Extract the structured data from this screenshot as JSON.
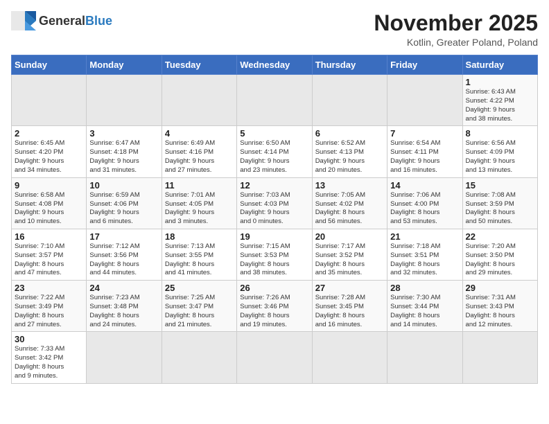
{
  "logo": {
    "text_general": "General",
    "text_blue": "Blue"
  },
  "header": {
    "title": "November 2025",
    "subtitle": "Kotlin, Greater Poland, Poland"
  },
  "weekdays": [
    "Sunday",
    "Monday",
    "Tuesday",
    "Wednesday",
    "Thursday",
    "Friday",
    "Saturday"
  ],
  "weeks": [
    [
      {
        "day": "",
        "info": ""
      },
      {
        "day": "",
        "info": ""
      },
      {
        "day": "",
        "info": ""
      },
      {
        "day": "",
        "info": ""
      },
      {
        "day": "",
        "info": ""
      },
      {
        "day": "",
        "info": ""
      },
      {
        "day": "1",
        "info": "Sunrise: 6:43 AM\nSunset: 4:22 PM\nDaylight: 9 hours\nand 38 minutes."
      }
    ],
    [
      {
        "day": "2",
        "info": "Sunrise: 6:45 AM\nSunset: 4:20 PM\nDaylight: 9 hours\nand 34 minutes."
      },
      {
        "day": "3",
        "info": "Sunrise: 6:47 AM\nSunset: 4:18 PM\nDaylight: 9 hours\nand 31 minutes."
      },
      {
        "day": "4",
        "info": "Sunrise: 6:49 AM\nSunset: 4:16 PM\nDaylight: 9 hours\nand 27 minutes."
      },
      {
        "day": "5",
        "info": "Sunrise: 6:50 AM\nSunset: 4:14 PM\nDaylight: 9 hours\nand 23 minutes."
      },
      {
        "day": "6",
        "info": "Sunrise: 6:52 AM\nSunset: 4:13 PM\nDaylight: 9 hours\nand 20 minutes."
      },
      {
        "day": "7",
        "info": "Sunrise: 6:54 AM\nSunset: 4:11 PM\nDaylight: 9 hours\nand 16 minutes."
      },
      {
        "day": "8",
        "info": "Sunrise: 6:56 AM\nSunset: 4:09 PM\nDaylight: 9 hours\nand 13 minutes."
      }
    ],
    [
      {
        "day": "9",
        "info": "Sunrise: 6:58 AM\nSunset: 4:08 PM\nDaylight: 9 hours\nand 10 minutes."
      },
      {
        "day": "10",
        "info": "Sunrise: 6:59 AM\nSunset: 4:06 PM\nDaylight: 9 hours\nand 6 minutes."
      },
      {
        "day": "11",
        "info": "Sunrise: 7:01 AM\nSunset: 4:05 PM\nDaylight: 9 hours\nand 3 minutes."
      },
      {
        "day": "12",
        "info": "Sunrise: 7:03 AM\nSunset: 4:03 PM\nDaylight: 9 hours\nand 0 minutes."
      },
      {
        "day": "13",
        "info": "Sunrise: 7:05 AM\nSunset: 4:02 PM\nDaylight: 8 hours\nand 56 minutes."
      },
      {
        "day": "14",
        "info": "Sunrise: 7:06 AM\nSunset: 4:00 PM\nDaylight: 8 hours\nand 53 minutes."
      },
      {
        "day": "15",
        "info": "Sunrise: 7:08 AM\nSunset: 3:59 PM\nDaylight: 8 hours\nand 50 minutes."
      }
    ],
    [
      {
        "day": "16",
        "info": "Sunrise: 7:10 AM\nSunset: 3:57 PM\nDaylight: 8 hours\nand 47 minutes."
      },
      {
        "day": "17",
        "info": "Sunrise: 7:12 AM\nSunset: 3:56 PM\nDaylight: 8 hours\nand 44 minutes."
      },
      {
        "day": "18",
        "info": "Sunrise: 7:13 AM\nSunset: 3:55 PM\nDaylight: 8 hours\nand 41 minutes."
      },
      {
        "day": "19",
        "info": "Sunrise: 7:15 AM\nSunset: 3:53 PM\nDaylight: 8 hours\nand 38 minutes."
      },
      {
        "day": "20",
        "info": "Sunrise: 7:17 AM\nSunset: 3:52 PM\nDaylight: 8 hours\nand 35 minutes."
      },
      {
        "day": "21",
        "info": "Sunrise: 7:18 AM\nSunset: 3:51 PM\nDaylight: 8 hours\nand 32 minutes."
      },
      {
        "day": "22",
        "info": "Sunrise: 7:20 AM\nSunset: 3:50 PM\nDaylight: 8 hours\nand 29 minutes."
      }
    ],
    [
      {
        "day": "23",
        "info": "Sunrise: 7:22 AM\nSunset: 3:49 PM\nDaylight: 8 hours\nand 27 minutes."
      },
      {
        "day": "24",
        "info": "Sunrise: 7:23 AM\nSunset: 3:48 PM\nDaylight: 8 hours\nand 24 minutes."
      },
      {
        "day": "25",
        "info": "Sunrise: 7:25 AM\nSunset: 3:47 PM\nDaylight: 8 hours\nand 21 minutes."
      },
      {
        "day": "26",
        "info": "Sunrise: 7:26 AM\nSunset: 3:46 PM\nDaylight: 8 hours\nand 19 minutes."
      },
      {
        "day": "27",
        "info": "Sunrise: 7:28 AM\nSunset: 3:45 PM\nDaylight: 8 hours\nand 16 minutes."
      },
      {
        "day": "28",
        "info": "Sunrise: 7:30 AM\nSunset: 3:44 PM\nDaylight: 8 hours\nand 14 minutes."
      },
      {
        "day": "29",
        "info": "Sunrise: 7:31 AM\nSunset: 3:43 PM\nDaylight: 8 hours\nand 12 minutes."
      }
    ],
    [
      {
        "day": "30",
        "info": "Sunrise: 7:33 AM\nSunset: 3:42 PM\nDaylight: 8 hours\nand 9 minutes."
      },
      {
        "day": "",
        "info": ""
      },
      {
        "day": "",
        "info": ""
      },
      {
        "day": "",
        "info": ""
      },
      {
        "day": "",
        "info": ""
      },
      {
        "day": "",
        "info": ""
      },
      {
        "day": "",
        "info": ""
      }
    ]
  ]
}
